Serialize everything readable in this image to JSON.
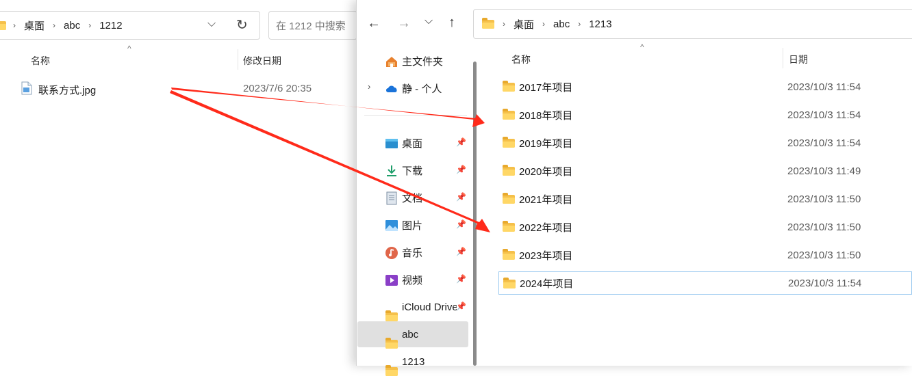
{
  "left_window": {
    "breadcrumb": [
      "桌面",
      "abc",
      "1212"
    ],
    "search_placeholder": "在 1212 中搜索",
    "columns": {
      "name": "名称",
      "modified": "修改日期"
    },
    "file": {
      "name": "联系方式.jpg",
      "date": "2023/7/6 20:35"
    }
  },
  "right_window": {
    "breadcrumb": [
      "桌面",
      "abc",
      "1213"
    ],
    "columns": {
      "name": "名称",
      "date": "日期"
    },
    "sidebar": {
      "home": "主文件夹",
      "onedrive": "静 - 个人",
      "pinned": [
        {
          "label": "桌面",
          "icon": "desktop-icon"
        },
        {
          "label": "下载",
          "icon": "download-icon"
        },
        {
          "label": "文档",
          "icon": "document-icon"
        },
        {
          "label": "图片",
          "icon": "picture-icon"
        },
        {
          "label": "音乐",
          "icon": "music-icon"
        },
        {
          "label": "视频",
          "icon": "video-icon"
        },
        {
          "label": "iCloud Drive",
          "icon": "folder-icon"
        }
      ],
      "abc": "abc",
      "sub": "1213"
    },
    "rows": [
      {
        "name": "2017年项目",
        "date": "2023/10/3 11:54"
      },
      {
        "name": "2018年项目",
        "date": "2023/10/3 11:54"
      },
      {
        "name": "2019年项目",
        "date": "2023/10/3 11:54"
      },
      {
        "name": "2020年项目",
        "date": "2023/10/3 11:49"
      },
      {
        "name": "2021年项目",
        "date": "2023/10/3 11:50"
      },
      {
        "name": "2022年项目",
        "date": "2023/10/3 11:50"
      },
      {
        "name": "2023年项目",
        "date": "2023/10/3 11:50"
      },
      {
        "name": "2024年项目",
        "date": "2023/10/3 11:54"
      }
    ]
  },
  "colors": {
    "arrow": "#ff2a1a",
    "selection": "#e0e0e0",
    "folder": "#f5c04a"
  }
}
